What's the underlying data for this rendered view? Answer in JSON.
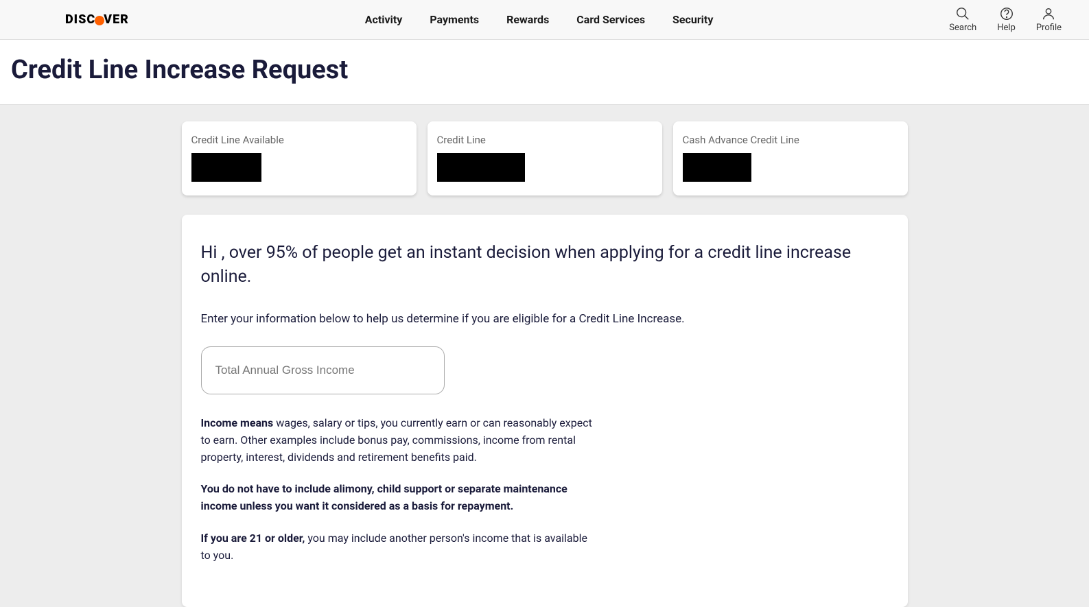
{
  "logo": {
    "part1": "DISC",
    "part2": "VER"
  },
  "nav": {
    "items": [
      "Activity",
      "Payments",
      "Rewards",
      "Card Services",
      "Security"
    ]
  },
  "header_icons": {
    "search": "Search",
    "help": "Help",
    "profile": "Profile"
  },
  "page": {
    "title": "Credit Line Increase Request"
  },
  "credit_info": {
    "available_label": "Credit Line Available",
    "line_label": "Credit Line",
    "cash_advance_label": "Cash Advance Credit Line"
  },
  "form": {
    "greeting": "Hi       , over 95% of people get an instant decision when applying for a credit line increase online.",
    "instruction": "Enter your information below to help us determine if you are eligible for a Credit Line Increase.",
    "income_placeholder": "Total Annual Gross Income",
    "disclaimer1_bold": "Income means",
    "disclaimer1_rest": " wages, salary or tips, you currently earn or can reasonably expect to earn. Other examples include bonus pay, commissions, income from rental property, interest, dividends and retirement benefits paid.",
    "disclaimer2": "You do not have to include alimony, child support or separate maintenance income unless you want it considered as a basis for repayment.",
    "disclaimer3_bold": "If you are 21 or older,",
    "disclaimer3_rest": " you may include another person's income that is available to you."
  }
}
